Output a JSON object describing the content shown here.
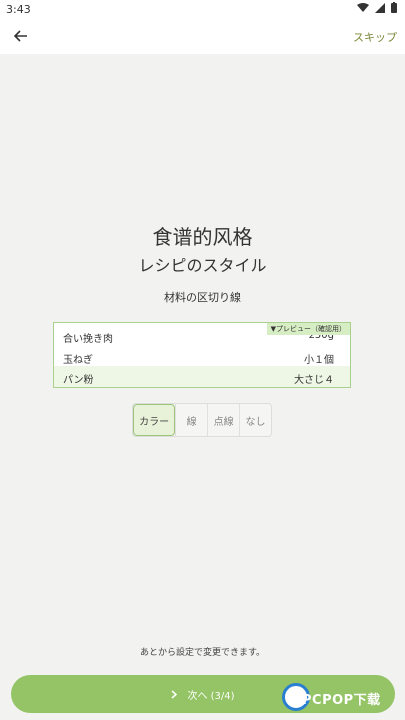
{
  "status": {
    "time": "3:43"
  },
  "appbar": {
    "skip_label": "スキップ"
  },
  "main": {
    "title": "食谱的风格",
    "subtitle": "レシピのスタイル",
    "section_label": "材料の区切り線",
    "preview_badge": "▼プレビュー（確認用）",
    "ingredients": [
      {
        "name": "合い挽き肉",
        "amount": "250g"
      },
      {
        "name": "玉ねぎ",
        "amount": "小１個"
      },
      {
        "name": "パン粉",
        "amount": "大さじ４"
      }
    ],
    "options": [
      "カラー",
      "線",
      "点線",
      "なし"
    ],
    "selected_option": "カラー",
    "note": "あとから設定で変更できます。",
    "next_label": "次へ (3/4)"
  },
  "watermark": {
    "text": "PCPOP下载"
  },
  "colors": {
    "accent": "#94c465",
    "skip": "#7a8a3a"
  }
}
